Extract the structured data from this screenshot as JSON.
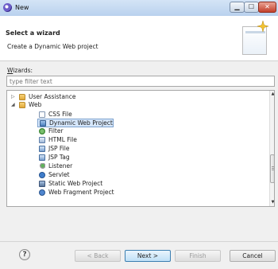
{
  "window": {
    "title": "New"
  },
  "header": {
    "title": "Select a wizard",
    "description": "Create a Dynamic Web project"
  },
  "wizards": {
    "label": "Wizards:",
    "label_mnemonic": "W",
    "label_rest": "izards:",
    "filter_placeholder": "type filter text"
  },
  "tree": {
    "items": [
      {
        "label": "User Assistance",
        "icon": "folder-icon",
        "expanded": false
      },
      {
        "label": "Web",
        "icon": "folder-icon",
        "expanded": true
      },
      {
        "label": "CSS File",
        "icon": "css-file-icon"
      },
      {
        "label": "Dynamic Web Project",
        "icon": "dynamic-web-project-icon",
        "selected": true
      },
      {
        "label": "Filter",
        "icon": "filter-icon"
      },
      {
        "label": "HTML File",
        "icon": "html-file-icon"
      },
      {
        "label": "JSP File",
        "icon": "jsp-file-icon"
      },
      {
        "label": "JSP Tag",
        "icon": "jsp-tag-icon"
      },
      {
        "label": "Listener",
        "icon": "listener-icon"
      },
      {
        "label": "Servlet",
        "icon": "servlet-icon"
      },
      {
        "label": "Static Web Project",
        "icon": "static-web-project-icon"
      },
      {
        "label": "Web Fragment Project",
        "icon": "web-fragment-project-icon"
      }
    ]
  },
  "footer": {
    "help_icon": "?",
    "back": {
      "mnemonic": "B",
      "label": "< Back",
      "enabled": false
    },
    "next": {
      "mnemonic": "N",
      "label": "Next >",
      "enabled": true
    },
    "finish": {
      "mnemonic": "F",
      "label": "Finish",
      "enabled": false
    },
    "cancel": {
      "label": "Cancel",
      "enabled": true
    }
  }
}
